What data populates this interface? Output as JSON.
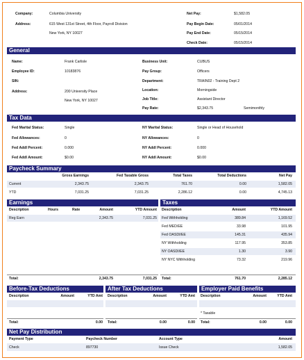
{
  "header": {
    "company_label": "Company:",
    "company": "Columbia University",
    "address_label": "Address:",
    "address_line1": "615 West 131st Street, 4th Floor, Payroll Division",
    "address_line2": "New York, NY 10027",
    "net_pay_label": "Net Pay:",
    "net_pay": "$1,582.05",
    "pay_begin_label": "Pay Begin Date:",
    "pay_begin": "05/01/2014",
    "pay_end_label": "Pay End Date:",
    "pay_end": "05/15/2014",
    "check_date_label": "Check Date:",
    "check_date": "05/15/2014"
  },
  "general": {
    "title": "General",
    "name_label": "Name:",
    "name": "Frank Carlisle",
    "employee_id_label": "Employee ID:",
    "employee_id": "10183876",
    "sin_label": "SIN:",
    "address_label": "Address:",
    "address_line1": "200 University Place",
    "address_line2": "New York, NY 10027",
    "business_unit_label": "Business Unit:",
    "business_unit": "CUBUS",
    "pay_group_label": "Pay Group:",
    "pay_group": "Officers",
    "department_label": "Department:",
    "department": "TRAIN02 - Training Dept 2",
    "location_label": "Location:",
    "location": "Morningside",
    "job_title_label": "Job Title:",
    "job_title": "Assistant Director",
    "pay_rate_label": "Pay Rate:",
    "pay_rate": "$2,343.75",
    "pay_frequency": "Semimonthly"
  },
  "tax_data": {
    "title": "Tax Data",
    "fed_marital_label": "Fed Marital Status:",
    "fed_marital": "Single",
    "fed_allowances_label": "Fed Allowances:",
    "fed_allowances": "0",
    "fed_addl_pct_label": "Fed Addl Percent:",
    "fed_addl_pct": "0.000",
    "fed_addl_amt_label": "Fed Addl Amount:",
    "fed_addl_amt": "$0.00",
    "ny_marital_label": "NY Marital Status:",
    "ny_marital": "Single or Head of Household",
    "ny_allowances_label": "NY Allowances:",
    "ny_allowances": "0",
    "ny_addl_pct_label": "NY Addl Percent:",
    "ny_addl_pct": "0.000",
    "ny_addl_amt_label": "NY Addl Amount:",
    "ny_addl_amt": "$0.00"
  },
  "paycheck_summary": {
    "title": "Paycheck Summary",
    "headers": [
      "Gross Earnings",
      "Fed Taxable Gross",
      "Total Taxes",
      "Total Deductions",
      "Net Pay"
    ],
    "rows": [
      {
        "label": "Current",
        "values": [
          "2,343.75",
          "2,343.75",
          "761.70",
          "0.00",
          "1,582.05"
        ]
      },
      {
        "label": "YTD",
        "values": [
          "7,031.25",
          "7,031.25",
          "2,286.12",
          "0.00",
          "4,745.13"
        ]
      }
    ]
  },
  "earnings": {
    "title": "Earnings",
    "headers": {
      "description": "Description",
      "hours": "Hours",
      "rate": "Rate",
      "amount": "Amount",
      "ytd": "YTD Amount"
    },
    "rows": [
      {
        "description": "Reg Earn",
        "hours": "",
        "rate": "",
        "amount": "",
        "ytd": "7,031.25"
      }
    ],
    "total_label": "Total:",
    "total_amount": "2,343.75",
    "total_ytd": "7,031.25"
  },
  "earnings_row_amount": "2,343.75",
  "taxes": {
    "title": "Taxes",
    "headers": {
      "description": "Description",
      "amount": "Amount",
      "ytd": "YTD Amount"
    },
    "rows": [
      {
        "description": "Fed Withholding",
        "amount": "389.84",
        "ytd": "1,169.52"
      },
      {
        "description": "Fed MED/EE",
        "amount": "33.98",
        "ytd": "101.95"
      },
      {
        "description": "Fed OASDI/EE",
        "amount": "145.31",
        "ytd": "435.94"
      },
      {
        "description": "NY Withholding",
        "amount": "117.95",
        "ytd": "353.85"
      },
      {
        "description": "NY OASDI/EE",
        "amount": "1.30",
        "ytd": "3.90"
      },
      {
        "description": "NY NYC Withholding",
        "amount": "73.32",
        "ytd": "219.96"
      }
    ],
    "total_label": "Total:",
    "total_amount": "761.70",
    "total_ytd": "2,285.12"
  },
  "before_tax": {
    "title": "Before-Tax Deductions",
    "headers": {
      "description": "Description",
      "amount": "Amount",
      "ytd": "YTD Amt"
    },
    "total_label": "Total:",
    "total_amount": "0.00",
    "total_ytd": "0.00"
  },
  "after_tax": {
    "title": "After Tax Deductions",
    "headers": {
      "description": "Description",
      "amount": "Amount",
      "ytd": "YTD Amt"
    },
    "total_label": "Total:",
    "total_amount": "0.00",
    "total_ytd": "0.00"
  },
  "employer_paid": {
    "title": "Employer Paid Benefits",
    "headers": {
      "description": "Description",
      "amount": "Amount",
      "ytd": "YTD Amt"
    },
    "note": "* Taxable",
    "total_label": "Total:",
    "total_amount": "0.00",
    "total_ytd": "0.00"
  },
  "net_pay_distribution": {
    "title": "Net Pay Distribution",
    "headers": {
      "payment_type": "Payment Type",
      "paycheck_number": "Paycheck Number",
      "account_type": "Account Type",
      "amount": "Amount"
    },
    "rows": [
      {
        "payment_type": "Check",
        "paycheck_number": "897730",
        "account_type": "Issue Check",
        "amount": "1,582.05"
      }
    ]
  }
}
